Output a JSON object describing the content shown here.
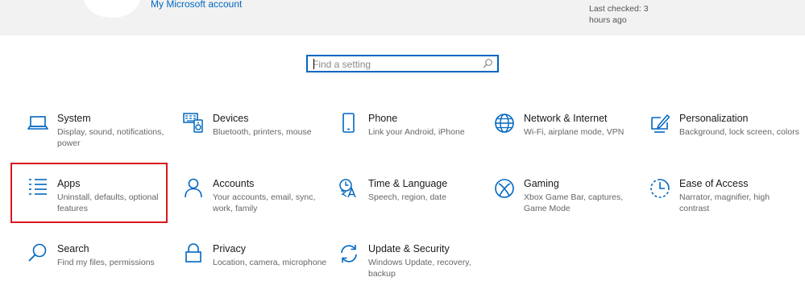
{
  "header": {
    "ms_account_link": "My Microsoft account",
    "last_checked": "Last checked: 3 hours ago"
  },
  "search": {
    "placeholder": "Find a setting"
  },
  "tiles": [
    {
      "title": "System",
      "desc": "Display, sound, notifications, power",
      "icon": "laptop-icon"
    },
    {
      "title": "Devices",
      "desc": "Bluetooth, printers, mouse",
      "icon": "devices-icon"
    },
    {
      "title": "Phone",
      "desc": "Link your Android, iPhone",
      "icon": "phone-icon"
    },
    {
      "title": "Network & Internet",
      "desc": "Wi-Fi, airplane mode, VPN",
      "icon": "globe-icon"
    },
    {
      "title": "Personalization",
      "desc": "Background, lock screen, colors",
      "icon": "personalization-icon"
    },
    {
      "title": "Apps",
      "desc": "Uninstall, defaults, optional features",
      "icon": "apps-list-icon"
    },
    {
      "title": "Accounts",
      "desc": "Your accounts, email, sync, work, family",
      "icon": "person-icon"
    },
    {
      "title": "Time & Language",
      "desc": "Speech, region, date",
      "icon": "time-language-icon"
    },
    {
      "title": "Gaming",
      "desc": "Xbox Game Bar, captures, Game Mode",
      "icon": "xbox-icon"
    },
    {
      "title": "Ease of Access",
      "desc": "Narrator, magnifier, high contrast",
      "icon": "ease-of-access-icon"
    },
    {
      "title": "Search",
      "desc": "Find my files, permissions",
      "icon": "search-icon"
    },
    {
      "title": "Privacy",
      "desc": "Location, camera, microphone",
      "icon": "lock-icon"
    },
    {
      "title": "Update & Security",
      "desc": "Windows Update, recovery, backup",
      "icon": "sync-icon"
    }
  ],
  "colors": {
    "accent": "#0067c0",
    "highlight": "#d9181e",
    "band": "#f2f2f2"
  }
}
